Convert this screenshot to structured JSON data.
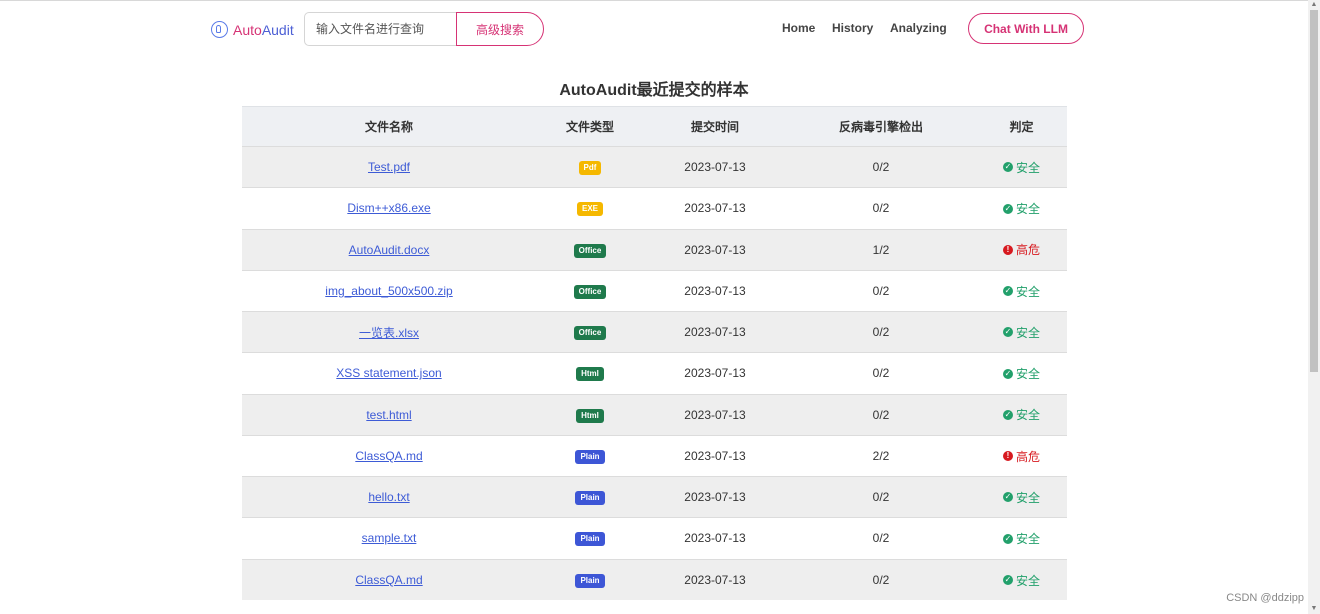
{
  "header": {
    "logo_text_a": "Auto",
    "logo_text_b": "Audit",
    "search_placeholder": "输入文件名进行查询",
    "advanced_search_label": "高级搜索",
    "nav": {
      "home": "Home",
      "history": "History",
      "analyzing": "Analyzing"
    },
    "chat_label": "Chat With LLM"
  },
  "main": {
    "title": "AutoAudit最近提交的样本",
    "columns": [
      "文件名称",
      "文件类型",
      "提交时间",
      "反病毒引擎检出",
      "判定"
    ],
    "rows": [
      {
        "name": "Test.pdf",
        "type": "Pdf",
        "type_color": "#f5b800",
        "time": "2023-07-13",
        "detect": "0/2",
        "verdict": "安全",
        "level": "safe"
      },
      {
        "name": "Dism++x86.exe",
        "type": "EXE",
        "type_color": "#f5b800",
        "time": "2023-07-13",
        "detect": "0/2",
        "verdict": "安全",
        "level": "safe"
      },
      {
        "name": "AutoAudit.docx",
        "type": "Office",
        "type_color": "#1f7a4c",
        "time": "2023-07-13",
        "detect": "1/2",
        "verdict": "高危",
        "level": "danger"
      },
      {
        "name": "img_about_500x500.zip",
        "type": "Office",
        "type_color": "#1f7a4c",
        "time": "2023-07-13",
        "detect": "0/2",
        "verdict": "安全",
        "level": "safe"
      },
      {
        "name": "一览表.xlsx",
        "type": "Office",
        "type_color": "#1f7a4c",
        "time": "2023-07-13",
        "detect": "0/2",
        "verdict": "安全",
        "level": "safe"
      },
      {
        "name": "XSS statement.json",
        "type": "Html",
        "type_color": "#1f7a4c",
        "time": "2023-07-13",
        "detect": "0/2",
        "verdict": "安全",
        "level": "safe"
      },
      {
        "name": "test.html",
        "type": "Html",
        "type_color": "#1f7a4c",
        "time": "2023-07-13",
        "detect": "0/2",
        "verdict": "安全",
        "level": "safe"
      },
      {
        "name": "ClassQA.md",
        "type": "Plain",
        "type_color": "#3d56d6",
        "time": "2023-07-13",
        "detect": "2/2",
        "verdict": "高危",
        "level": "danger"
      },
      {
        "name": "hello.txt",
        "type": "Plain",
        "type_color": "#3d56d6",
        "time": "2023-07-13",
        "detect": "0/2",
        "verdict": "安全",
        "level": "safe"
      },
      {
        "name": "sample.txt",
        "type": "Plain",
        "type_color": "#3d56d6",
        "time": "2023-07-13",
        "detect": "0/2",
        "verdict": "安全",
        "level": "safe"
      },
      {
        "name": "ClassQA.md",
        "type": "Plain",
        "type_color": "#3d56d6",
        "time": "2023-07-13",
        "detect": "0/2",
        "verdict": "安全",
        "level": "safe"
      }
    ]
  },
  "colors": {
    "accent": "#d63375",
    "link": "#3d5bd6",
    "safe": "#22a06b",
    "danger": "#d7191f"
  },
  "icons": {
    "logo": "robot-icon",
    "safe": "check-circle-icon",
    "danger": "exclamation-circle-icon"
  },
  "watermark": "CSDN @ddzipp"
}
